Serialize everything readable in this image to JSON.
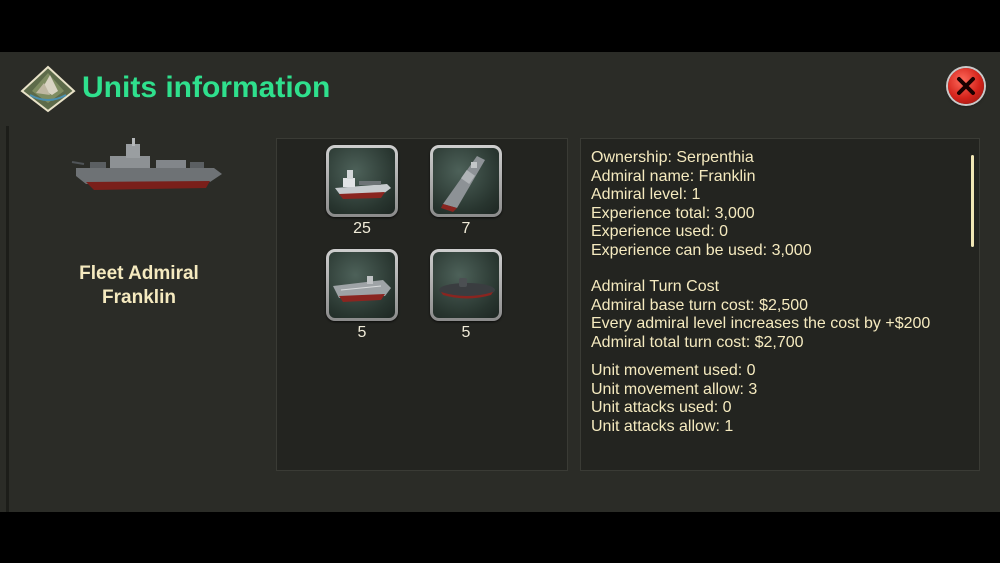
{
  "title": "Units information",
  "admiral": {
    "rank": "Fleet Admiral",
    "name": "Franklin"
  },
  "units": [
    {
      "icon": "cargo-ship-icon",
      "count": "25"
    },
    {
      "icon": "destroyer-icon",
      "count": "7"
    },
    {
      "icon": "aircraft-carrier-icon",
      "count": "5"
    },
    {
      "icon": "submarine-icon",
      "count": "5"
    }
  ],
  "info": {
    "ownership": "Ownership: Serpenthia",
    "admiral_name": "Admiral name: Franklin",
    "admiral_level": "Admiral level: 1",
    "experience_total": "Experience total: 3,000",
    "experience_used": "Experience used: 0",
    "experience_available": "Experience can be used: 3,000",
    "turn_cost_header": "Admiral Turn Cost",
    "base_turn_cost": "Admiral base turn cost: $2,500",
    "level_increase": "Every admiral level increases the cost by +$200",
    "total_turn_cost": "Admiral total turn cost: $2,700",
    "movement_used": "Unit movement used: 0",
    "movement_allow": "Unit movement allow: 3",
    "attacks_used": "Unit attacks used: 0",
    "attacks_allow": "Unit attacks allow: 1"
  },
  "colors": {
    "title": "#2fe08d",
    "text": "#f5eabf",
    "panel": "#232420",
    "dialog": "#2b2c27",
    "close": "#d4231b"
  }
}
